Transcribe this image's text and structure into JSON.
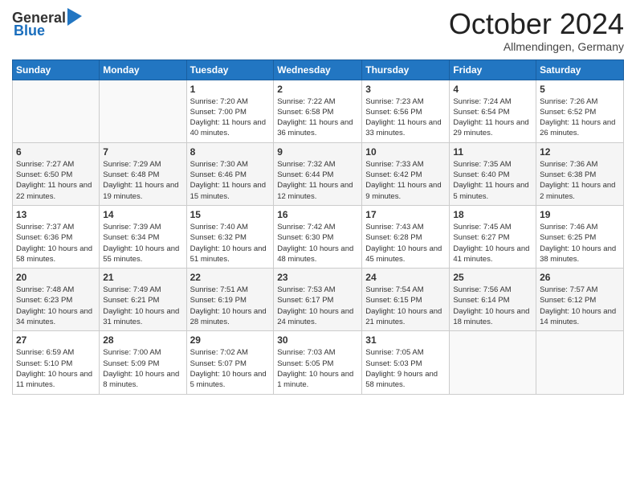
{
  "header": {
    "logo_general": "General",
    "logo_blue": "Blue",
    "month": "October 2024",
    "location": "Allmendingen, Germany"
  },
  "weekdays": [
    "Sunday",
    "Monday",
    "Tuesday",
    "Wednesday",
    "Thursday",
    "Friday",
    "Saturday"
  ],
  "weeks": [
    [
      {
        "day": "",
        "info": ""
      },
      {
        "day": "",
        "info": ""
      },
      {
        "day": "1",
        "info": "Sunrise: 7:20 AM\nSunset: 7:00 PM\nDaylight: 11 hours and 40 minutes."
      },
      {
        "day": "2",
        "info": "Sunrise: 7:22 AM\nSunset: 6:58 PM\nDaylight: 11 hours and 36 minutes."
      },
      {
        "day": "3",
        "info": "Sunrise: 7:23 AM\nSunset: 6:56 PM\nDaylight: 11 hours and 33 minutes."
      },
      {
        "day": "4",
        "info": "Sunrise: 7:24 AM\nSunset: 6:54 PM\nDaylight: 11 hours and 29 minutes."
      },
      {
        "day": "5",
        "info": "Sunrise: 7:26 AM\nSunset: 6:52 PM\nDaylight: 11 hours and 26 minutes."
      }
    ],
    [
      {
        "day": "6",
        "info": "Sunrise: 7:27 AM\nSunset: 6:50 PM\nDaylight: 11 hours and 22 minutes."
      },
      {
        "day": "7",
        "info": "Sunrise: 7:29 AM\nSunset: 6:48 PM\nDaylight: 11 hours and 19 minutes."
      },
      {
        "day": "8",
        "info": "Sunrise: 7:30 AM\nSunset: 6:46 PM\nDaylight: 11 hours and 15 minutes."
      },
      {
        "day": "9",
        "info": "Sunrise: 7:32 AM\nSunset: 6:44 PM\nDaylight: 11 hours and 12 minutes."
      },
      {
        "day": "10",
        "info": "Sunrise: 7:33 AM\nSunset: 6:42 PM\nDaylight: 11 hours and 9 minutes."
      },
      {
        "day": "11",
        "info": "Sunrise: 7:35 AM\nSunset: 6:40 PM\nDaylight: 11 hours and 5 minutes."
      },
      {
        "day": "12",
        "info": "Sunrise: 7:36 AM\nSunset: 6:38 PM\nDaylight: 11 hours and 2 minutes."
      }
    ],
    [
      {
        "day": "13",
        "info": "Sunrise: 7:37 AM\nSunset: 6:36 PM\nDaylight: 10 hours and 58 minutes."
      },
      {
        "day": "14",
        "info": "Sunrise: 7:39 AM\nSunset: 6:34 PM\nDaylight: 10 hours and 55 minutes."
      },
      {
        "day": "15",
        "info": "Sunrise: 7:40 AM\nSunset: 6:32 PM\nDaylight: 10 hours and 51 minutes."
      },
      {
        "day": "16",
        "info": "Sunrise: 7:42 AM\nSunset: 6:30 PM\nDaylight: 10 hours and 48 minutes."
      },
      {
        "day": "17",
        "info": "Sunrise: 7:43 AM\nSunset: 6:28 PM\nDaylight: 10 hours and 45 minutes."
      },
      {
        "day": "18",
        "info": "Sunrise: 7:45 AM\nSunset: 6:27 PM\nDaylight: 10 hours and 41 minutes."
      },
      {
        "day": "19",
        "info": "Sunrise: 7:46 AM\nSunset: 6:25 PM\nDaylight: 10 hours and 38 minutes."
      }
    ],
    [
      {
        "day": "20",
        "info": "Sunrise: 7:48 AM\nSunset: 6:23 PM\nDaylight: 10 hours and 34 minutes."
      },
      {
        "day": "21",
        "info": "Sunrise: 7:49 AM\nSunset: 6:21 PM\nDaylight: 10 hours and 31 minutes."
      },
      {
        "day": "22",
        "info": "Sunrise: 7:51 AM\nSunset: 6:19 PM\nDaylight: 10 hours and 28 minutes."
      },
      {
        "day": "23",
        "info": "Sunrise: 7:53 AM\nSunset: 6:17 PM\nDaylight: 10 hours and 24 minutes."
      },
      {
        "day": "24",
        "info": "Sunrise: 7:54 AM\nSunset: 6:15 PM\nDaylight: 10 hours and 21 minutes."
      },
      {
        "day": "25",
        "info": "Sunrise: 7:56 AM\nSunset: 6:14 PM\nDaylight: 10 hours and 18 minutes."
      },
      {
        "day": "26",
        "info": "Sunrise: 7:57 AM\nSunset: 6:12 PM\nDaylight: 10 hours and 14 minutes."
      }
    ],
    [
      {
        "day": "27",
        "info": "Sunrise: 6:59 AM\nSunset: 5:10 PM\nDaylight: 10 hours and 11 minutes."
      },
      {
        "day": "28",
        "info": "Sunrise: 7:00 AM\nSunset: 5:09 PM\nDaylight: 10 hours and 8 minutes."
      },
      {
        "day": "29",
        "info": "Sunrise: 7:02 AM\nSunset: 5:07 PM\nDaylight: 10 hours and 5 minutes."
      },
      {
        "day": "30",
        "info": "Sunrise: 7:03 AM\nSunset: 5:05 PM\nDaylight: 10 hours and 1 minute."
      },
      {
        "day": "31",
        "info": "Sunrise: 7:05 AM\nSunset: 5:03 PM\nDaylight: 9 hours and 58 minutes."
      },
      {
        "day": "",
        "info": ""
      },
      {
        "day": "",
        "info": ""
      }
    ]
  ]
}
